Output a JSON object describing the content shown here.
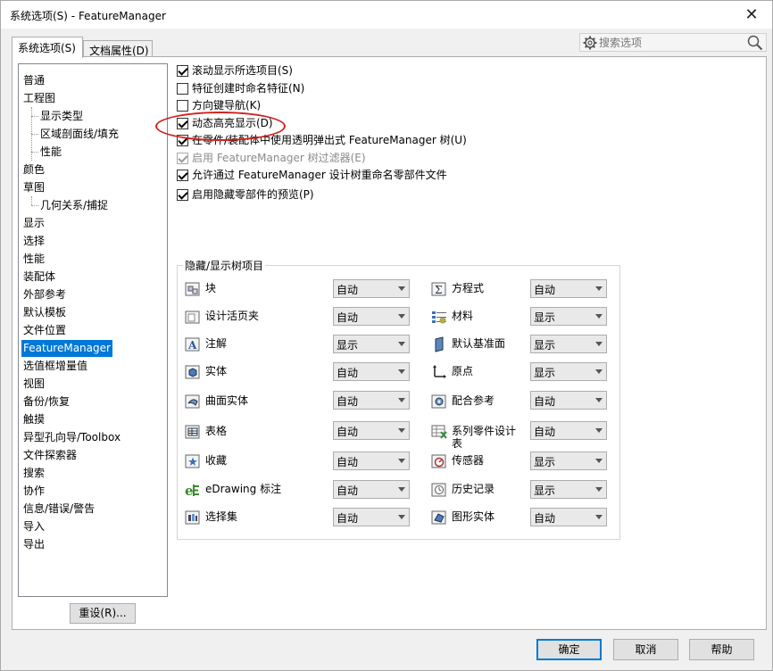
{
  "window": {
    "title": "系统选项(S) - FeatureManager",
    "close_glyph": "✕"
  },
  "tabs": [
    {
      "label": "系统选项(S)"
    },
    {
      "label": "文档属性(D)"
    }
  ],
  "search": {
    "placeholder": "搜索选项"
  },
  "tree": {
    "items": [
      {
        "label": "普通"
      },
      {
        "label": "工程图"
      },
      {
        "label": "显示类型"
      },
      {
        "label": "区域剖面线/填充"
      },
      {
        "label": "性能"
      },
      {
        "label": "颜色"
      },
      {
        "label": "草图"
      },
      {
        "label": "几何关系/捕捉"
      },
      {
        "label": "显示"
      },
      {
        "label": "选择"
      },
      {
        "label": "性能"
      },
      {
        "label": "装配体"
      },
      {
        "label": "外部参考"
      },
      {
        "label": "默认模板"
      },
      {
        "label": "文件位置"
      },
      {
        "label": "FeatureManager"
      },
      {
        "label": "选值框增量值"
      },
      {
        "label": "视图"
      },
      {
        "label": "备份/恢复"
      },
      {
        "label": "触摸"
      },
      {
        "label": "异型孔向导/Toolbox"
      },
      {
        "label": "文件探索器"
      },
      {
        "label": "搜索"
      },
      {
        "label": "协作"
      },
      {
        "label": "信息/错误/警告"
      },
      {
        "label": "导入"
      },
      {
        "label": "导出"
      }
    ],
    "reset_label": "重设(R)..."
  },
  "options": [
    {
      "label": "滚动显示所选项目(S)",
      "checked": true
    },
    {
      "label": "特征创建时命名特征(N)",
      "checked": false
    },
    {
      "label": "方向键导航(K)",
      "checked": false
    },
    {
      "label": "动态高亮显示(D)",
      "checked": true
    },
    {
      "label": "在零件/装配体中使用透明弹出式 FeatureManager 树(U)",
      "checked": true
    },
    {
      "label": "启用 FeatureManager 树过滤器(E)",
      "checked": true,
      "disabled": true
    },
    {
      "label": "允许通过 FeatureManager 设计树重命名零部件文件",
      "checked": true
    },
    {
      "label": "启用隐藏零部件的预览(P)",
      "checked": true
    }
  ],
  "hide_show": {
    "title": "隐藏/显示树项目",
    "left": [
      {
        "label": "块",
        "value": "自动",
        "icon": "block-icon"
      },
      {
        "label": "设计活页夹",
        "value": "自动",
        "icon": "design-binder-icon"
      },
      {
        "label": "注解",
        "value": "显示",
        "icon": "annotation-icon"
      },
      {
        "label": "实体",
        "value": "自动",
        "icon": "solid-body-icon"
      },
      {
        "label": "曲面实体",
        "value": "自动",
        "icon": "surface-body-icon"
      },
      {
        "label": "表格",
        "value": "自动",
        "icon": "table-icon"
      },
      {
        "label": "收藏",
        "value": "自动",
        "icon": "favorites-icon"
      },
      {
        "label": "eDrawing 标注",
        "value": "自动",
        "icon": "edrawing-markup-icon"
      },
      {
        "label": "选择集",
        "value": "自动",
        "icon": "selection-set-icon"
      }
    ],
    "right": [
      {
        "label": "方程式",
        "value": "自动",
        "icon": "equation-icon"
      },
      {
        "label": "材料",
        "value": "显示",
        "icon": "material-icon"
      },
      {
        "label": "默认基准面",
        "value": "显示",
        "icon": "default-plane-icon"
      },
      {
        "label": "原点",
        "value": "显示",
        "icon": "origin-icon"
      },
      {
        "label": "配合参考",
        "value": "自动",
        "icon": "mate-reference-icon"
      },
      {
        "label": "系列零件设计表",
        "value": "自动",
        "icon": "design-table-icon"
      },
      {
        "label": "传感器",
        "value": "显示",
        "icon": "sensor-icon"
      },
      {
        "label": "历史记录",
        "value": "显示",
        "icon": "history-icon"
      },
      {
        "label": "图形实体",
        "value": "自动",
        "icon": "graphics-body-icon"
      }
    ]
  },
  "buttons": {
    "ok": "确定",
    "cancel": "取消",
    "help": "帮助"
  }
}
